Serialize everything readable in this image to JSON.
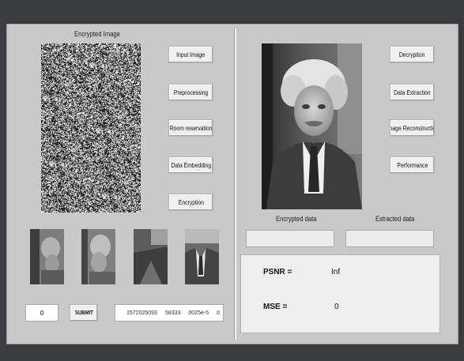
{
  "left_panel": {
    "encrypted_image_label": "Encrypted Image",
    "buttons": {
      "input_image": "Input Image",
      "preprocessing": "Preprocessing",
      "room_reservation": "Room reservation",
      "data_embedding": "Data Embedding",
      "encryption": "Encryption"
    },
    "input_value": "0",
    "submit_label": "SUBMIT",
    "list_values": [
      "1572025093",
      "58333",
      "0025e-5",
      "0"
    ]
  },
  "right_panel": {
    "buttons": {
      "decryption": "Decryption",
      "data_extraction": "Data Extraction",
      "image_reconstruction": "Image Reconstruction",
      "performance": "Performance"
    },
    "encrypted_data_label": "Encrypted data",
    "extracted_data_label": "Extracted data",
    "encrypted_data_value": "",
    "extracted_data_value": ""
  },
  "results": {
    "psnr_label": "PSNR =",
    "psnr_value": "Inf",
    "mse_label": "MSE =",
    "mse_value": "0"
  },
  "colors": {
    "window_bg": "#3a3b3d",
    "panel_bg": "#c9c9c9",
    "button_bg": "#f0f0f0"
  }
}
